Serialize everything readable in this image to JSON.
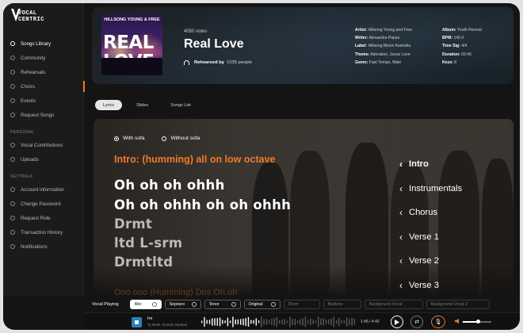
{
  "brand": {
    "line1": "VOCAL",
    "line2": "CENTRIC"
  },
  "sidebar": {
    "main": [
      {
        "label": "Songs Library",
        "active": true
      },
      {
        "label": "Community"
      },
      {
        "label": "Rehearsals"
      },
      {
        "label": "Choirs",
        "selected": true
      },
      {
        "label": "Events"
      },
      {
        "label": "Request Songs"
      }
    ],
    "personal_heading": "PERSONAL",
    "personal": [
      {
        "label": "Vocal Contributions"
      },
      {
        "label": "Uploads"
      }
    ],
    "settings_heading": "SETTINGS",
    "settings": [
      {
        "label": "Account information"
      },
      {
        "label": "Change Password"
      },
      {
        "label": "Request Role"
      },
      {
        "label": "Transaction History"
      },
      {
        "label": "Notifications"
      }
    ]
  },
  "song": {
    "cover_top": "HILLSONG YOUNG & FREE",
    "cover_title": "REAL LOVE",
    "votes": "4050 votes",
    "title": "Real Love",
    "rehearsed_label": "Rehearsed by",
    "rehearsed_count": "1035 people",
    "meta_left": [
      {
        "key": "Artist:",
        "value": "Hillsong Young and Free"
      },
      {
        "key": "Writer:",
        "value": "Alexandra Papas"
      },
      {
        "key": "Label:",
        "value": "Hillsong Music Australia"
      },
      {
        "key": "Theme:",
        "value": "Adoration, Jesus Love"
      },
      {
        "key": "Genre:",
        "value": "Fast Tempo, Male"
      }
    ],
    "meta_right": [
      {
        "key": "Album:",
        "value": "Youth Revival"
      },
      {
        "key": "BPM:",
        "value": "140.0"
      },
      {
        "key": "Time Sig:",
        "value": "4/4"
      },
      {
        "key": "Duration:",
        "value": "03:49"
      },
      {
        "key": "Keys:",
        "value": "8"
      }
    ]
  },
  "tabs": [
    {
      "label": "Lyrics",
      "active": true
    },
    {
      "label": "Slides"
    },
    {
      "label": "Songs List"
    }
  ],
  "lyrics": {
    "option_with": "With sofa",
    "option_without": "Without sofa",
    "section_label": "Intro: (humming) all on low octave",
    "lines": [
      "Oh oh oh ohhh",
      "Oh oh ohhh oh oh ohhh",
      "Drmt",
      "ltd L-srm",
      "Drmtltd"
    ],
    "next_section_peek": "Ooo ooo (Humming) Dos Oh oh"
  },
  "song_sections": [
    "Intro",
    "Instrumentals",
    "Chorus",
    "Verse 1",
    "Verse 2",
    "Verse 3"
  ],
  "vocal_playing": {
    "label": "Vocal Playing",
    "parts": [
      {
        "label": "Alto",
        "state": "selected"
      },
      {
        "label": "Soprano",
        "state": "on"
      },
      {
        "label": "Tenor",
        "state": "on"
      },
      {
        "label": "Original",
        "state": "on"
      },
      {
        "label": "Drum",
        "state": "disabled"
      },
      {
        "label": "Baritone",
        "state": "disabled"
      },
      {
        "label": "Background Vocal",
        "state": "disabled"
      },
      {
        "label": "Background Vocal 2",
        "state": "disabled"
      }
    ]
  },
  "player": {
    "title": "Ire",
    "artist": "Ty Bello, Dunsin Oyekan",
    "time": "1:45 / 4:42",
    "progress": 0.37,
    "volume": 0.55
  },
  "colors": {
    "accent": "#f07a28",
    "background": "#141414",
    "sidebar": "#1b1b1b"
  }
}
